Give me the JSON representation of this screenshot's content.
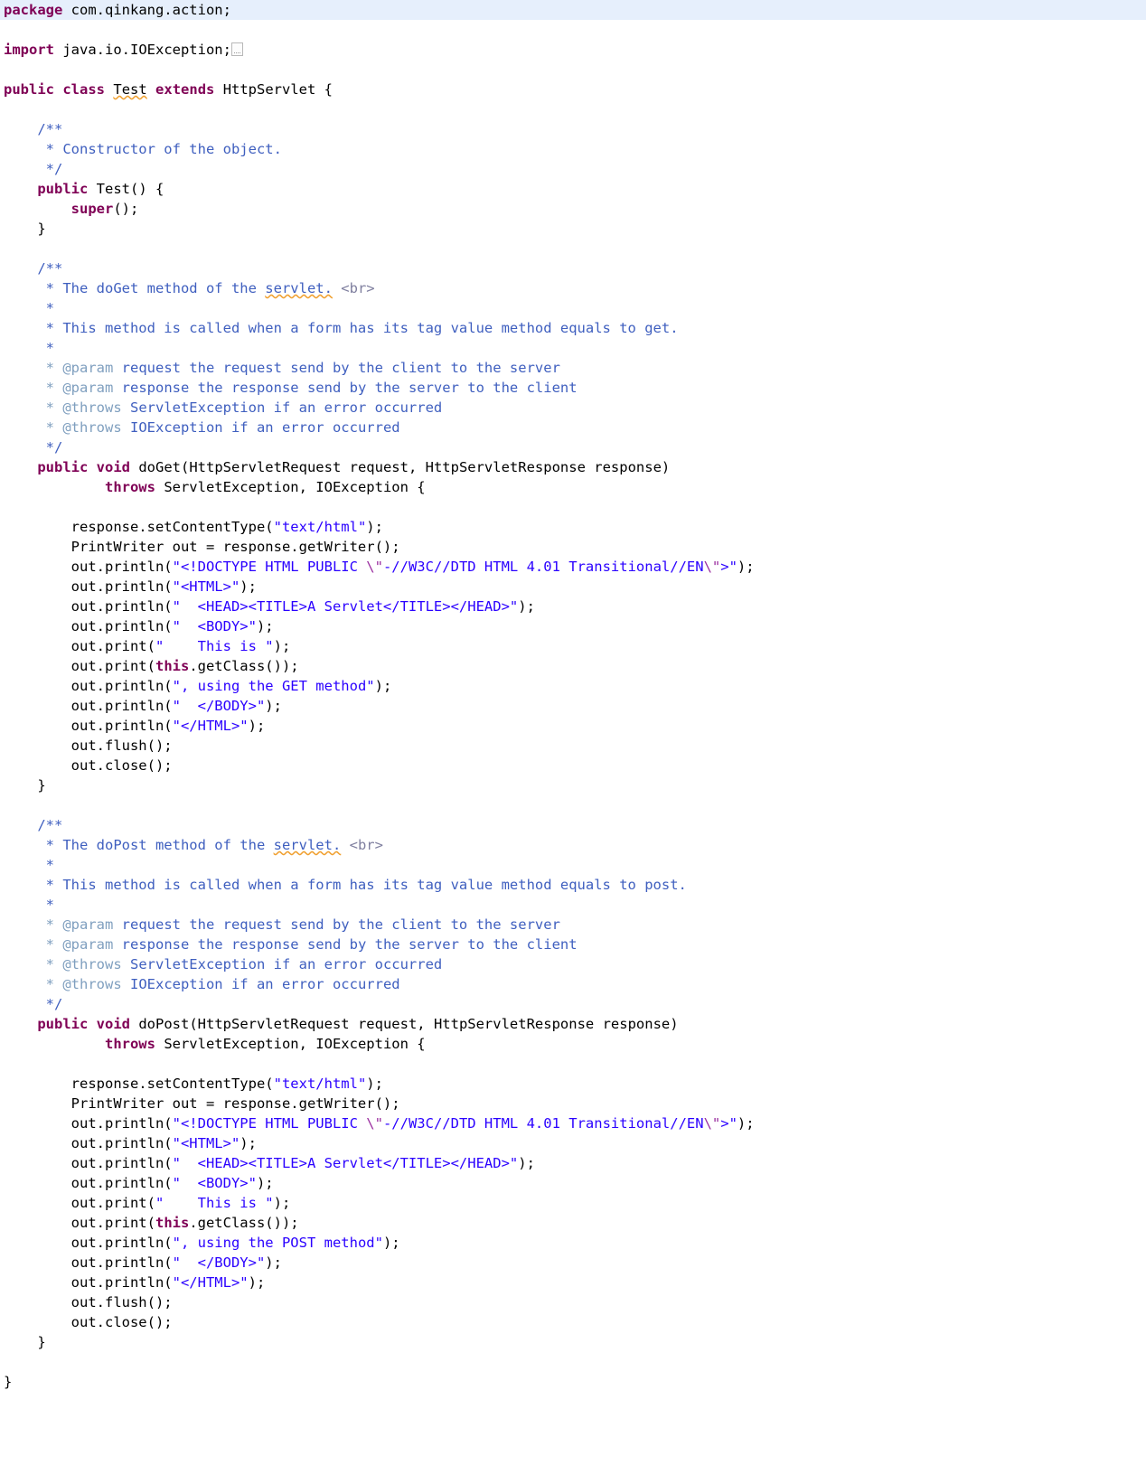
{
  "document": {
    "language": "Java",
    "type": "source-code-listing",
    "package": "com.qinkang.action",
    "class_name": "Test",
    "superclass": "HttpServlet",
    "colors": {
      "background": "#ffffff",
      "highlight_line": "#e6effc",
      "keyword": "#7f0055",
      "string": "#2a00ff",
      "escape": "#9b2fa0",
      "comment": "#3f5fbf",
      "javadoc_tag": "#7f9fbf",
      "plain": "#000000",
      "spell_squiggle": "#f0a030"
    },
    "fold_marker_icon": "collapsed-code-box-icon"
  },
  "code": {
    "l1_package_kw": "package",
    "l1_package_name": " com.qinkang.action;",
    "l3_import_kw": "import",
    "l3_import_name": " java.io.IOException;",
    "l5_public": "public",
    "l5_class": "class",
    "l5_name": "Test",
    "l5_extends": "extends",
    "l5_super": " HttpServlet {",
    "c1_open": "    /**",
    "c1_line1": "     * Constructor of the object.",
    "c1_close": "     */",
    "ctor_public": "    public",
    "ctor_sig": " Test() {",
    "ctor_super_kw": "        super",
    "ctor_super_rest": "();",
    "ctor_close": "    }",
    "doget_c_open": "    /**",
    "doget_c_1a": "     * The doGet method of the ",
    "doget_c_1b": "servlet.",
    "doget_c_1c": " <br>",
    "doget_c_2": "     *",
    "doget_c_3": "     * This method is called when a form has its tag value method equals to get.",
    "doget_c_4": "     *",
    "doget_c_5tag": "     * @param",
    "doget_c_5txt": " request the request send by the client to the server",
    "doget_c_6tag": "     * @param",
    "doget_c_6txt": " response the response send by the server to the client",
    "doget_c_7tag": "     * @throws",
    "doget_c_7txt": " ServletException if an error occurred",
    "doget_c_8tag": "     * @throws",
    "doget_c_8txt": " IOException if an error occurred",
    "doget_c_close": "     */",
    "doget_sig_public": "    public",
    "doget_sig_void": "void",
    "doget_sig_rest": " doGet(HttpServletRequest request, HttpServletResponse response)",
    "doget_throws_kw": "            throws",
    "doget_throws_rest": " ServletException, IOException {",
    "body_setct_a": "        response.setContentType(",
    "body_setct_s": "\"text/html\"",
    "body_setct_b": ");",
    "body_writer": "        PrintWriter out = response.getWriter();",
    "body_doctype_a": "        out.println(",
    "body_doctype_s1": "\"<!DOCTYPE HTML PUBLIC ",
    "body_doctype_e1": "\\\"",
    "body_doctype_s2": "-//W3C//DTD HTML 4.01 Transitional//EN",
    "body_doctype_e2": "\\\"",
    "body_doctype_s3": ">\"",
    "body_doctype_b": ");",
    "body_html_a": "        out.println(",
    "body_html_s": "\"<HTML>\"",
    "body_html_b": ");",
    "body_head_a": "        out.println(",
    "body_head_s": "\"  <HEAD><TITLE>A Servlet</TITLE></HEAD>\"",
    "body_head_b": ");",
    "body_bodyopen_a": "        out.println(",
    "body_bodyopen_s": "\"  <BODY>\"",
    "body_bodyopen_b": ");",
    "body_thisis_a": "        out.print(",
    "body_thisis_s": "\"    This is \"",
    "body_thisis_b": ");",
    "body_getclass_a": "        out.print(",
    "body_getclass_kw": "this",
    "body_getclass_b": ".getClass());",
    "body_get_a": "        out.println(",
    "body_get_s": "\", using the GET method\"",
    "body_get_b": ");",
    "body_post_s": "\", using the POST method\"",
    "body_bodyclose_a": "        out.println(",
    "body_bodyclose_s": "\"  </BODY>\"",
    "body_bodyclose_b": ");",
    "body_htmlclose_a": "        out.println(",
    "body_htmlclose_s": "\"</HTML>\"",
    "body_htmlclose_b": ");",
    "body_flush": "        out.flush();",
    "body_close": "        out.close();",
    "method_close": "    }",
    "dopost_c_open": "    /**",
    "dopost_c_1a": "     * The doPost method of the ",
    "dopost_c_1b": "servlet.",
    "dopost_c_1c": " <br>",
    "dopost_c_2": "     *",
    "dopost_c_3": "     * This method is called when a form has its tag value method equals to post.",
    "dopost_c_4": "     *",
    "dopost_c_5tag": "     * @param",
    "dopost_c_5txt": " request the request send by the client to the server",
    "dopost_c_6tag": "     * @param",
    "dopost_c_6txt": " response the response send by the server to the client",
    "dopost_c_7tag": "     * @throws",
    "dopost_c_7txt": " ServletException if an error occurred",
    "dopost_c_8tag": "     * @throws",
    "dopost_c_8txt": " IOException if an error occurred",
    "dopost_c_close": "     */",
    "dopost_sig_public": "    public",
    "dopost_sig_void": "void",
    "dopost_sig_rest": " doPost(HttpServletRequest request, HttpServletResponse response)",
    "dopost_throws_kw": "            throws",
    "dopost_throws_rest": " ServletException, IOException {",
    "class_close": "}"
  }
}
